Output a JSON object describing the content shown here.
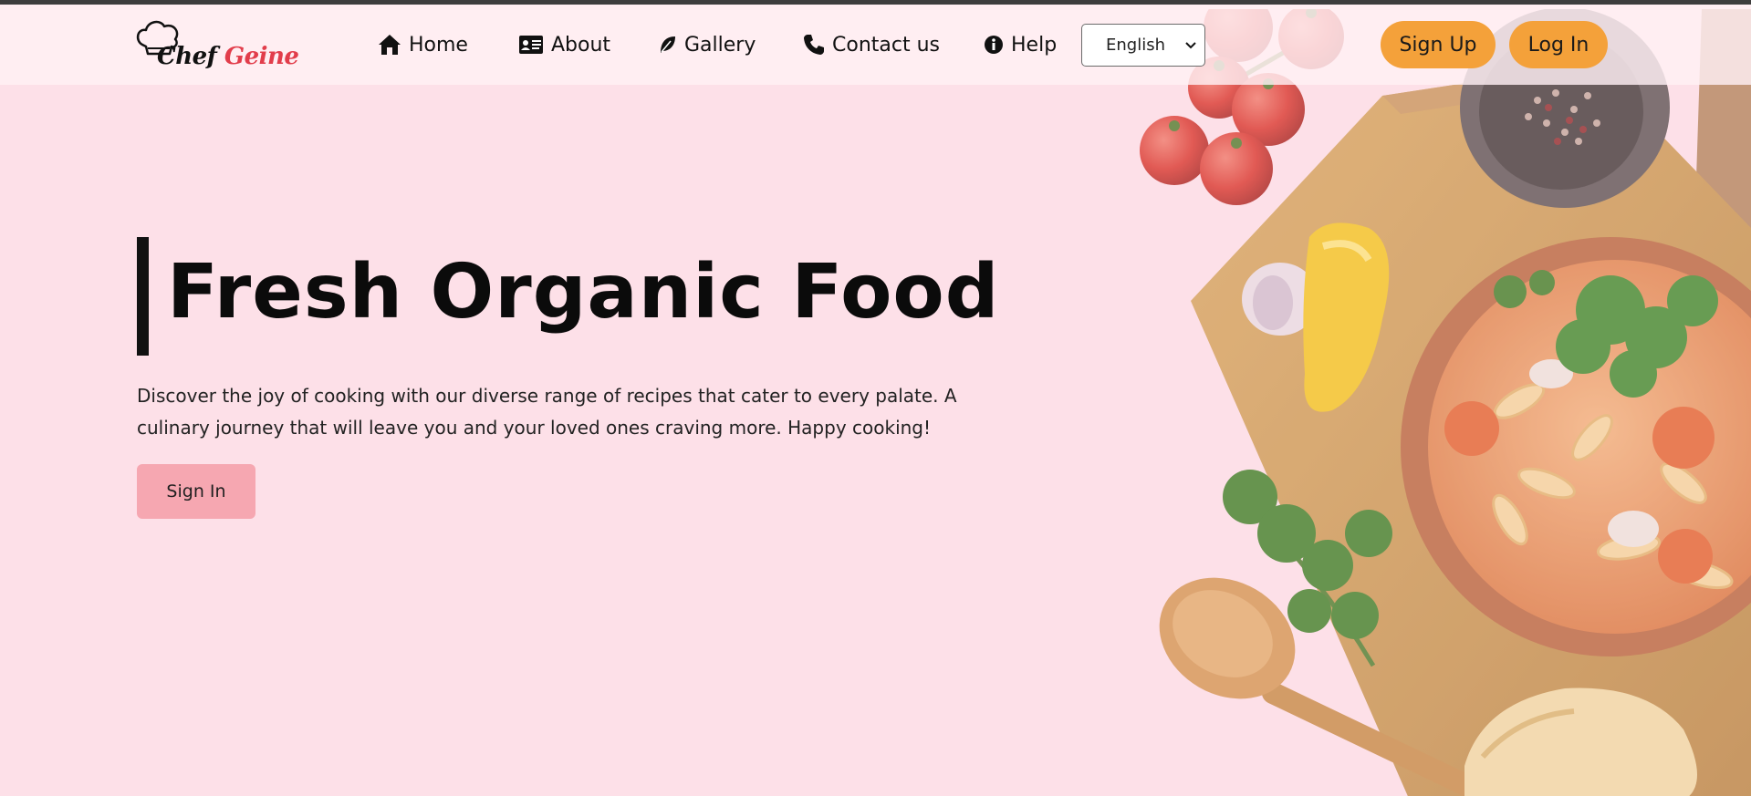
{
  "brand": {
    "name_part1": "Chef",
    "name_part2": "Geine"
  },
  "nav": [
    {
      "label": "Home",
      "icon": "home-icon"
    },
    {
      "label": "About",
      "icon": "id-card-icon"
    },
    {
      "label": "Gallery",
      "icon": "leaf-icon"
    },
    {
      "label": "Contact us",
      "icon": "phone-icon"
    },
    {
      "label": "Help",
      "icon": "info-icon"
    }
  ],
  "language": {
    "selected": "English"
  },
  "auth": {
    "signup_label": "Sign Up",
    "login_label": "Log In"
  },
  "hero": {
    "title": "Fresh Organic Food",
    "description": "Discover the joy of cooking with our diverse range of recipes that cater to every palate. A culinary journey that will leave you and your loved ones craving more. Happy cooking!",
    "cta_label": "Sign In"
  },
  "colors": {
    "background": "#fde0e8",
    "accent_button": "#f4a13a",
    "cta_button": "#f6a7b1",
    "brand_red": "#e23d4b"
  }
}
